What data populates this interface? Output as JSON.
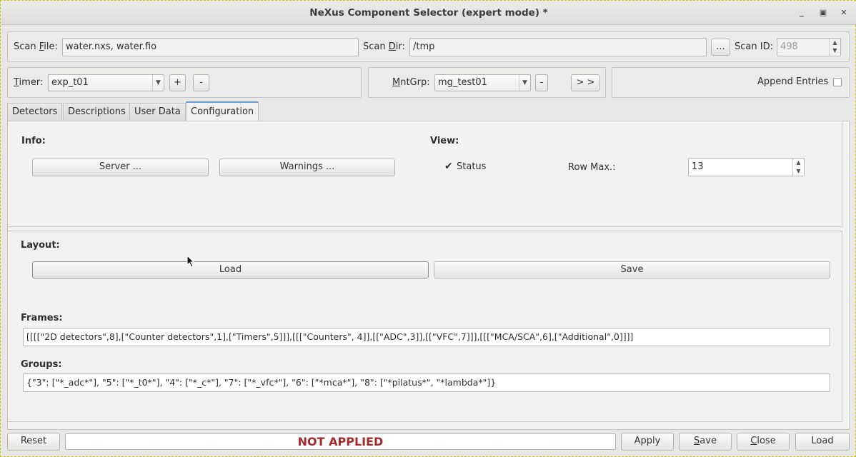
{
  "window": {
    "title": "NeXus Component Selector (expert mode) *"
  },
  "scan": {
    "file_label": "Scan File:",
    "file_value": "water.nxs, water.fio",
    "dir_label": "Scan Dir:",
    "dir_value": "/tmp",
    "browse_label": "...",
    "id_label": "Scan ID:",
    "id_value": "498"
  },
  "timer": {
    "label": "Timer:",
    "value": "exp_t01",
    "add_label": "+",
    "remove_label": "-"
  },
  "mntgrp": {
    "label": "MntGrp:",
    "value": "mg_test01",
    "remove_label": "-",
    "next_label": "> >"
  },
  "append": {
    "label": "Append Entries"
  },
  "tabs": [
    {
      "label": "Detectors"
    },
    {
      "label": "Descriptions"
    },
    {
      "label": "User Data"
    },
    {
      "label": "Configuration"
    }
  ],
  "info": {
    "heading": "Info:",
    "server_label": "Server ...",
    "warnings_label": "Warnings ..."
  },
  "view": {
    "heading": "View:",
    "status_label": "Status",
    "status_checked": true,
    "rowmax_label": "Row Max.:",
    "rowmax_value": "13"
  },
  "layout": {
    "heading": "Layout:",
    "load_label": "Load",
    "save_label": "Save"
  },
  "frames": {
    "heading": "Frames:",
    "value": "[[[[\"2D detectors\",8],[\"Counter detectors\",1],[\"Timers\",5]]],[[[\"Counters\", 4]],[[\"ADC\",3]],[[\"VFC\",7]]],[[[\"MCA/SCA\",6],[\"Additional\",0]]]]"
  },
  "groups": {
    "heading": "Groups:",
    "value": "{\"3\": [\"*_adc*\"], \"5\": [\"*_t0*\"], \"4\": [\"*_c*\"], \"7\": [\"*_vfc*\"], \"6\": [\"*mca*\"], \"8\": [\"*pilatus*\", \"*lambda*\"]}"
  },
  "footer": {
    "reset_label": "Reset",
    "status_text": "NOT APPLIED",
    "status_color": "#a52a2a",
    "apply_label": "Apply",
    "save_label": "Save",
    "close_label": "Close",
    "load_label": "Load"
  }
}
